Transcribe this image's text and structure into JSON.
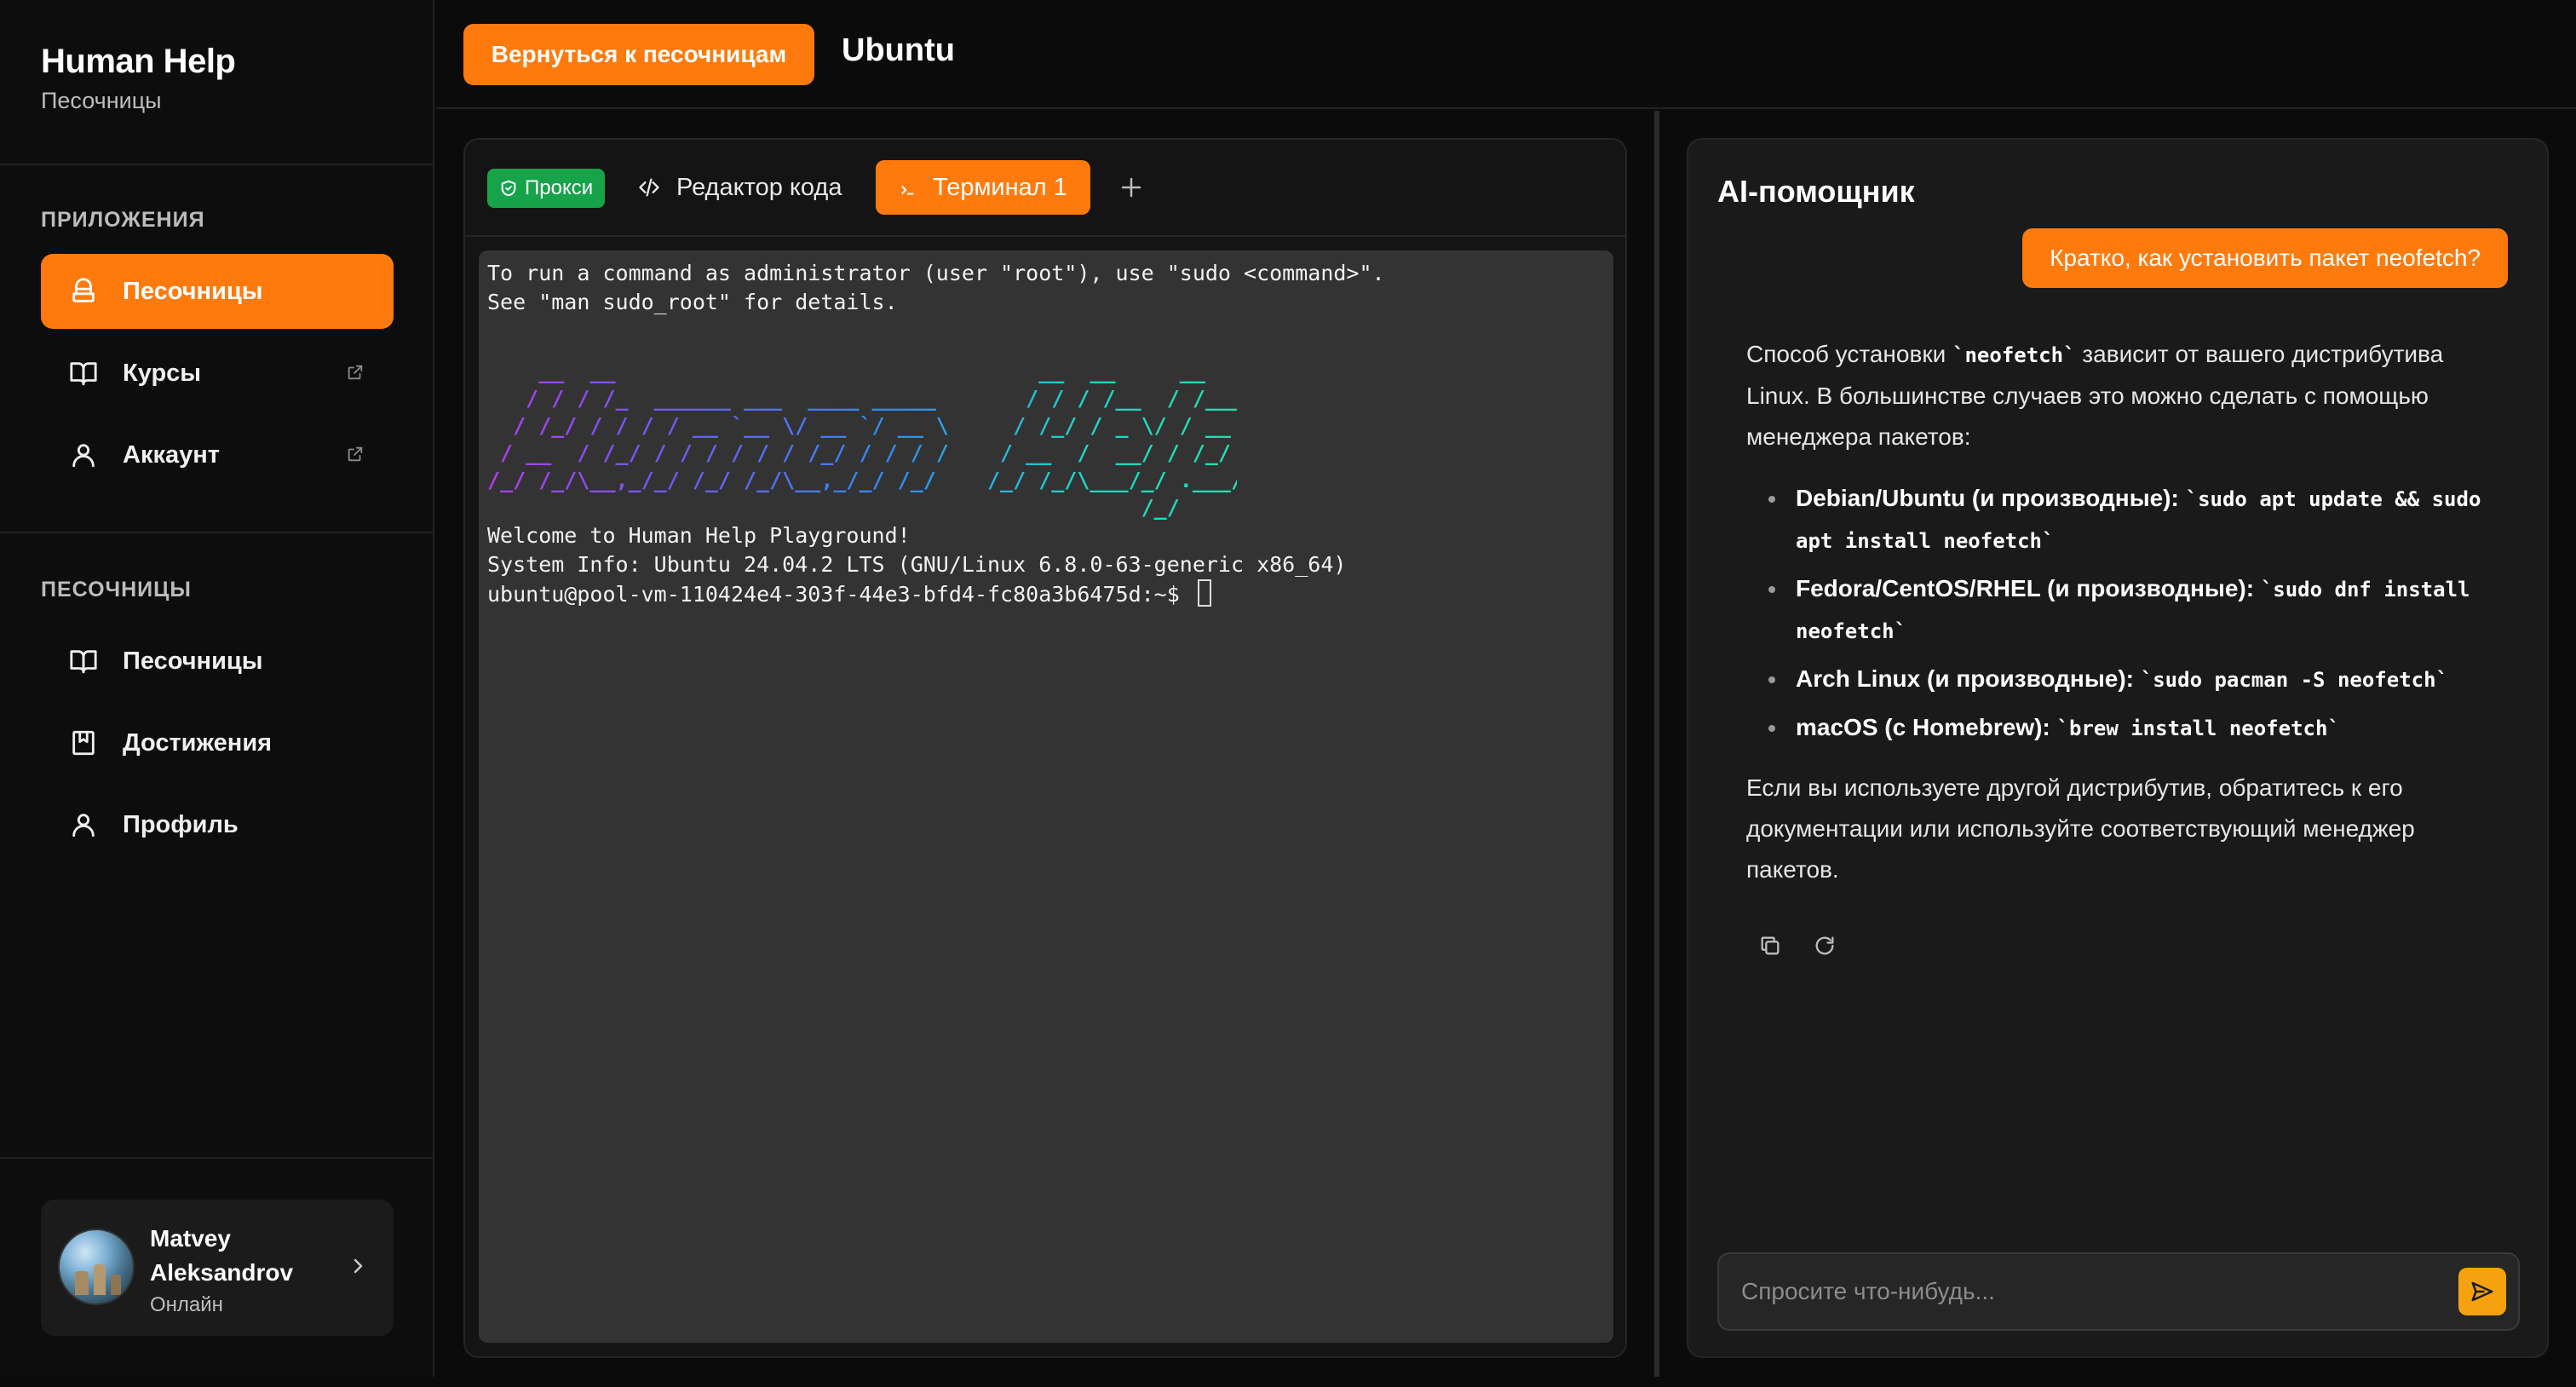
{
  "sidebar": {
    "brand_title": "Human Help",
    "brand_subtitle": "Песочницы",
    "apps_section_title": "ПРИЛОЖЕНИЯ",
    "apps": [
      {
        "label": "Песочницы",
        "icon": "sandbox-icon",
        "active": true
      },
      {
        "label": "Курсы",
        "icon": "book-icon",
        "external": true
      },
      {
        "label": "Аккаунт",
        "icon": "user-icon",
        "external": true
      }
    ],
    "sandbox_section_title": "ПЕСОЧНИЦЫ",
    "sandbox_items": [
      {
        "label": "Песочницы",
        "icon": "book-icon"
      },
      {
        "label": "Достижения",
        "icon": "achievement-icon"
      },
      {
        "label": "Профиль",
        "icon": "user-icon"
      }
    ],
    "user": {
      "name": "Matvey Aleksandrov",
      "status": "Онлайн"
    }
  },
  "header": {
    "back_label": "Вернуться к песочницам",
    "title": "Ubuntu"
  },
  "workspace": {
    "proxy_label": "Прокси",
    "tabs": [
      {
        "label": "Редактор кода",
        "icon": "code-icon"
      },
      {
        "label": "Терминал 1",
        "icon": "terminal-icon",
        "active": true
      }
    ],
    "add_tab": "+"
  },
  "terminal": {
    "lines_top": [
      "To run a command as administrator (user \"root\"), use \"sudo <command>\".",
      "See \"man sudo_root\" for details."
    ],
    "ascii_art": [
      "    __  __                                 __  __     __",
      "   / / / /_  ______ ___  ____ _____       / / / /__  / /___",
      "  / /_/ / / / / __ `__ \\/ __ `/ __ \\     / /_/ / _ \\/ / __ \\",
      " / __  / /_/ / / / / / / /_/ / / / /    / __  /  __/ / /_/ /",
      "/_/ /_/\\__,_/_/ /_/ /_/\\__,_/_/ /_/    /_/ /_/\\___/_/ .___/",
      "                                                   /_/"
    ],
    "lines_bottom": [
      "Welcome to Human Help Playground!",
      "System Info: Ubuntu 24.04.2 LTS (GNU/Linux 6.8.0-63-generic x86_64)"
    ],
    "prompt": "ubuntu@pool-vm-110424e4-303f-44e3-bfd4-fc80a3b6475d:~$ "
  },
  "assistant": {
    "title": "AI-помощник",
    "user_message": "Кратко, как установить пакет neofetch?",
    "answer_intro_1": "Способ установки ",
    "answer_intro_code": "`neofetch`",
    "answer_intro_2": " зависит от вашего дистрибутива Linux. В большинстве случаев это можно сделать с помощью менеджера пакетов:",
    "answer_items": [
      {
        "label": "Debian/Ubuntu (и производные):",
        "code": "`sudo apt update && sudo apt install neofetch`"
      },
      {
        "label": "Fedora/CentOS/RHEL (и производные):",
        "code": "`sudo dnf install neofetch`"
      },
      {
        "label": "Arch Linux (и производные):",
        "code": "`sudo pacman -S neofetch`"
      },
      {
        "label": "macOS (с Homebrew):",
        "code": "`brew install neofetch`"
      }
    ],
    "answer_outro": "Если вы используете другой дистрибутив, обратитесь к его документации или используйте соответствующий менеджер пакетов.",
    "input_placeholder": "Спросите что-нибудь..."
  },
  "colors": {
    "accent": "#ff7a0d",
    "proxy_green": "#16a34a",
    "send_button": "#f5a20e"
  }
}
